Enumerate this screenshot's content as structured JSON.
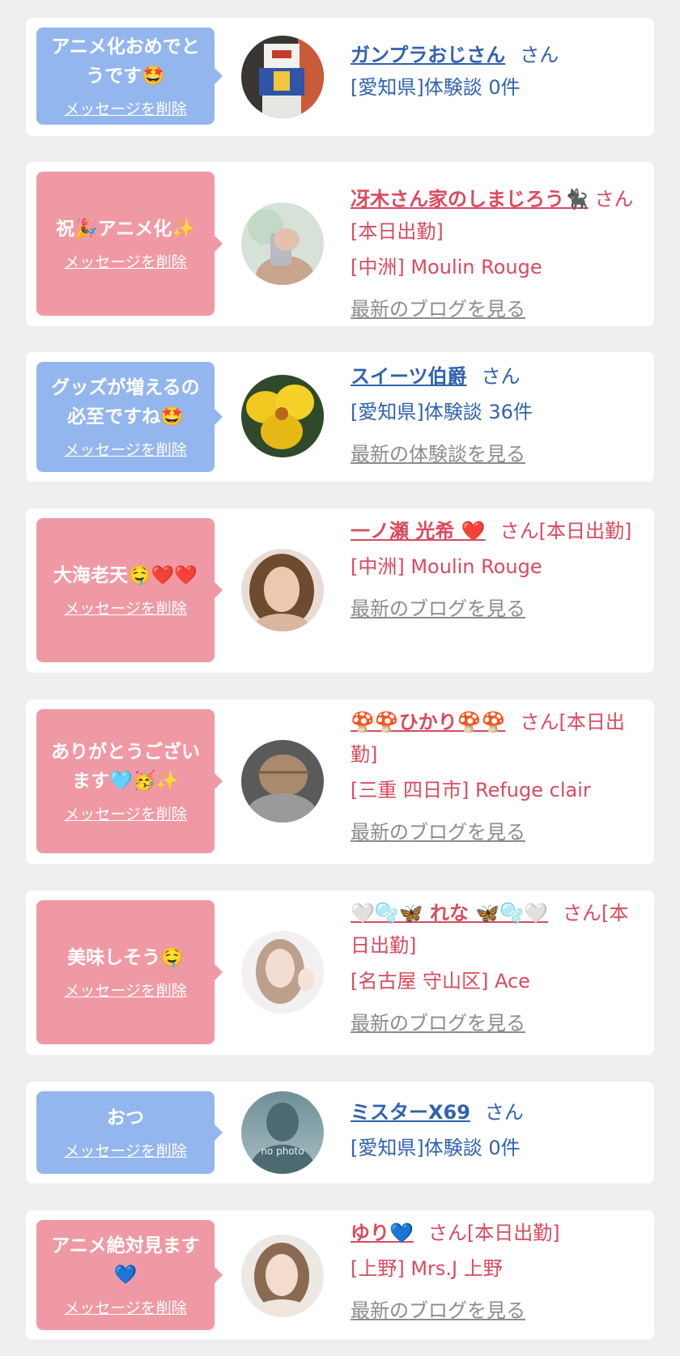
{
  "items": [
    {
      "message": "アニメ化おめでとうです🤩",
      "delete_label": "メッセージを削除",
      "name": "ガンプラおじさん",
      "suffix": "さん",
      "location": "[愛知県]体験談 0件",
      "link": ""
    },
    {
      "message": "祝🎉アニメ化✨",
      "delete_label": "メッセージを削除",
      "name": "冴木さん家のしまじろう🐈‍⬛",
      "suffix": "さん[本日出勤]",
      "location": "[中洲] Moulin Rouge",
      "link": "最新のブログを見る"
    },
    {
      "message": "グッズが増えるの必至ですね🤩",
      "delete_label": "メッセージを削除",
      "name": "スイーツ伯爵",
      "suffix": "さん",
      "location": "[愛知県]体験談 36件",
      "link": "最新の体験談を見る"
    },
    {
      "message": "大海老天🤤❤️❤️",
      "delete_label": "メッセージを削除",
      "name": "一ノ瀬 光希 ❤️",
      "suffix": "さん[本日出勤]",
      "location": "[中洲] Moulin Rouge",
      "link": "最新のブログを見る"
    },
    {
      "message": "ありがとうございます🩵🥳✨",
      "delete_label": "メッセージを削除",
      "name": "🍄🍄ひかり🍄🍄",
      "suffix": "さん[本日出勤]",
      "location": "[三重 四日市] Refuge clair",
      "link": "最新のブログを見る"
    },
    {
      "message": "美味しそう🤤",
      "delete_label": "メッセージを削除",
      "name": "🤍🫧🦋 れな 🦋🫧🤍",
      "suffix": "さん[本日出勤]",
      "location": "[名古屋 守山区] Ace",
      "link": "最新のブログを見る"
    },
    {
      "message": "おつ",
      "delete_label": "メッセージを削除",
      "name": "ミスターX69",
      "suffix": "さん",
      "location": "[愛知県]体験談 0件",
      "link": "",
      "avatar_text": "no photo"
    },
    {
      "message": "アニメ絶対見ます💙",
      "delete_label": "メッセージを削除",
      "name": "ゆり💙",
      "suffix": "さん[本日出勤]",
      "location": "[上野] Mrs.J 上野",
      "link": "最新のブログを見る"
    }
  ],
  "colors": {
    "page_bg": "#efeff0",
    "blue_bubble": "#94b6ee",
    "pink_bubble": "#ef99a4",
    "blue_text": "#2f62b0",
    "pink_text": "#db4a5e",
    "link_gray": "#8c8c8c"
  }
}
